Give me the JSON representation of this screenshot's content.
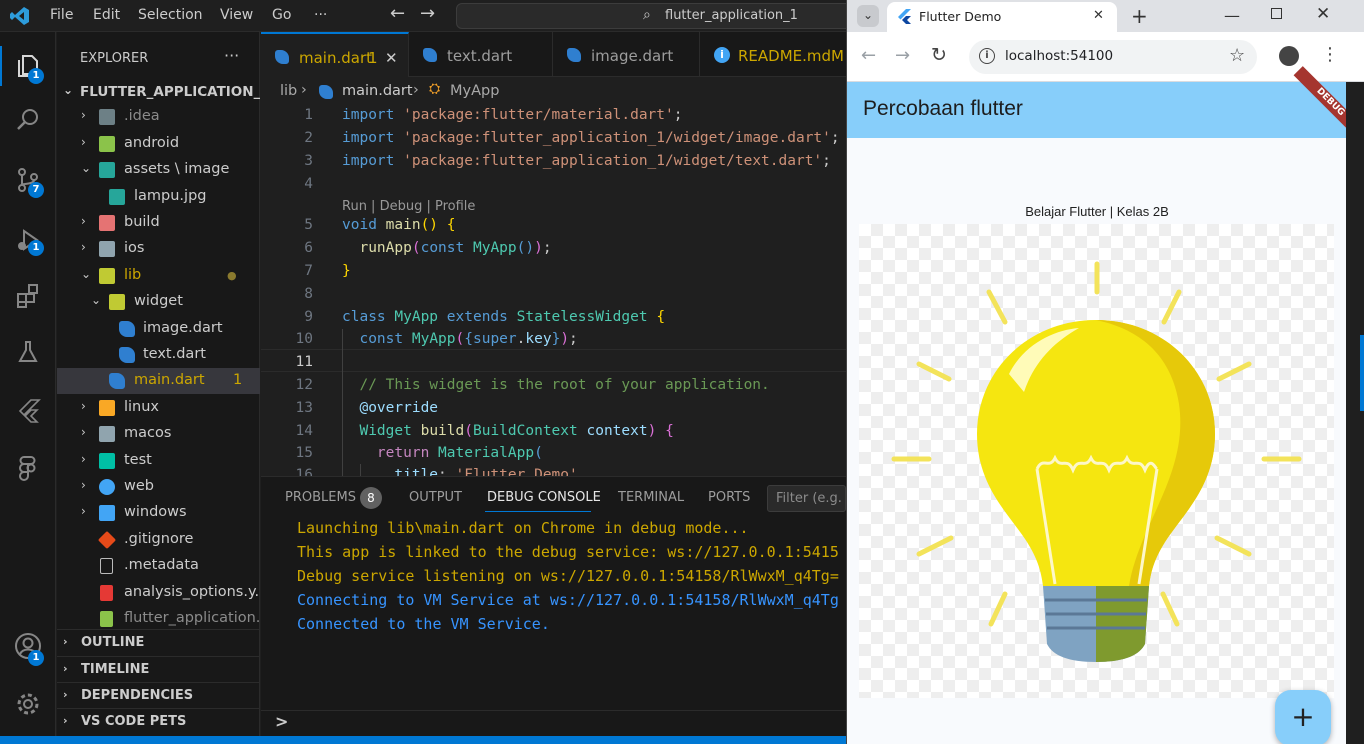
{
  "titlebar": {
    "menus": [
      "File",
      "Edit",
      "Selection",
      "View",
      "Go",
      "···"
    ],
    "search": "flutter_application_1"
  },
  "activity": {
    "badges": {
      "explorer": "1",
      "source_control": "7",
      "run": "1",
      "accounts": "1"
    }
  },
  "sidebar": {
    "title": "EXPLORER",
    "more": "···",
    "root": "FLUTTER_APPLICATION_1",
    "items": [
      {
        "label": ".idea",
        "badge": ""
      },
      {
        "label": "android",
        "badge": ""
      },
      {
        "label": "assets \\ image",
        "badge": ""
      },
      {
        "label": "lampu.jpg",
        "badge": ""
      },
      {
        "label": "build",
        "badge": ""
      },
      {
        "label": "ios",
        "badge": ""
      },
      {
        "label": "lib",
        "badge": "●"
      },
      {
        "label": "widget",
        "badge": ""
      },
      {
        "label": "image.dart",
        "badge": ""
      },
      {
        "label": "text.dart",
        "badge": ""
      },
      {
        "label": "main.dart",
        "badge": "1"
      },
      {
        "label": "linux",
        "badge": ""
      },
      {
        "label": "macos",
        "badge": ""
      },
      {
        "label": "test",
        "badge": ""
      },
      {
        "label": "web",
        "badge": ""
      },
      {
        "label": "windows",
        "badge": ""
      },
      {
        "label": ".gitignore",
        "badge": ""
      },
      {
        "label": ".metadata",
        "badge": ""
      },
      {
        "label": "analysis_options.y...",
        "badge": ""
      },
      {
        "label": "flutter_application...",
        "badge": ""
      }
    ],
    "sections": [
      "OUTLINE",
      "TIMELINE",
      "DEPENDENCIES",
      "VS CODE PETS"
    ]
  },
  "editor": {
    "tabs": [
      {
        "label": "main.dart",
        "badge": "1"
      },
      {
        "label": "text.dart",
        "badge": ""
      },
      {
        "label": "image.dart",
        "badge": ""
      },
      {
        "label": "README.md",
        "badge": "M"
      }
    ],
    "breadcrumb": {
      "folder": "lib",
      "file": "main.dart",
      "symbol": "MyApp"
    },
    "codelens": "Run | Debug | Profile",
    "line_numbers": [
      "1",
      "2",
      "3",
      "4",
      "5",
      "6",
      "7",
      "8",
      "9",
      "10",
      "11",
      "12",
      "13",
      "14",
      "15",
      "16"
    ]
  },
  "panel": {
    "tabs": [
      "PROBLEMS",
      "OUTPUT",
      "DEBUG CONSOLE",
      "TERMINAL",
      "PORTS"
    ],
    "problems_count": "8",
    "filter_placeholder": "Filter (e.g. t",
    "console": [
      "Launching lib\\main.dart on Chrome in debug mode...",
      "This app is linked to the debug service: ws://127.0.0.1:5415",
      "Debug service listening on ws://127.0.0.1:54158/RlWwxM_q4Tg=",
      "Connecting to VM Service at ws://127.0.0.1:54158/RlWwxM_q4Tg",
      "Connected to the VM Service."
    ],
    "prompt": ">"
  },
  "browser": {
    "tab_title": "Flutter Demo",
    "url": "localhost:54100",
    "app_title": "Percobaan flutter",
    "debug_banner": "DEBUG",
    "caption": "Belajar Flutter | Kelas 2B",
    "fab": "+"
  }
}
